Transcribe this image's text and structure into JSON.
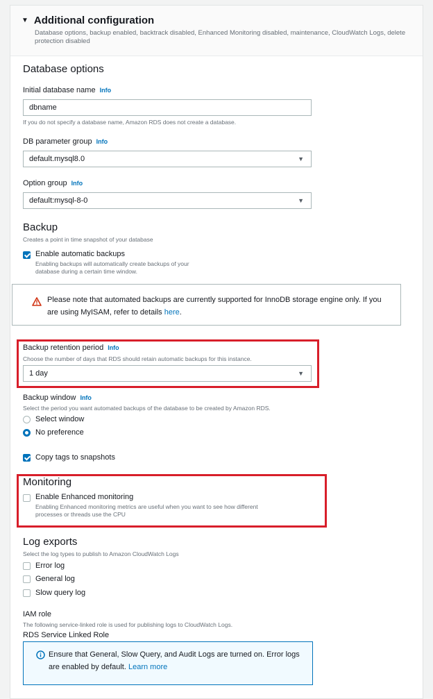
{
  "panel": {
    "title": "Additional configuration",
    "description": "Database options, backup enabled, backtrack disabled, Enhanced Monitoring disabled, maintenance, CloudWatch Logs, delete protection disabled"
  },
  "database_options": {
    "heading": "Database options",
    "initial_db_name": {
      "label": "Initial database name",
      "info": "Info",
      "value": "dbname",
      "hint": "If you do not specify a database name, Amazon RDS does not create a database."
    },
    "parameter_group": {
      "label": "DB parameter group",
      "info": "Info",
      "value": "default.mysql8.0"
    },
    "option_group": {
      "label": "Option group",
      "info": "Info",
      "value": "default:mysql-8-0"
    }
  },
  "backup": {
    "heading": "Backup",
    "description": "Creates a point in time snapshot of your database",
    "enable_auto": {
      "label": "Enable automatic backups",
      "description_line1": "Enabling backups will automatically create backups of your",
      "description_line2": "database during a certain time window.",
      "checked": true
    },
    "warning": {
      "text_line1": "Please note that automated backups are currently supported for InnoDB storage engine only. If you",
      "text_line2": "are using MyISAM, refer to details ",
      "link": "here",
      "suffix": "."
    },
    "retention": {
      "label": "Backup retention period",
      "info": "Info",
      "hint": "Choose the number of days that RDS should retain automatic backups for this instance.",
      "value": "1 day"
    },
    "window": {
      "label": "Backup window",
      "info": "Info",
      "hint": "Select the period you want automated backups of the database to be created by Amazon RDS.",
      "options": [
        {
          "label": "Select window",
          "selected": false
        },
        {
          "label": "No preference",
          "selected": true
        }
      ]
    },
    "copy_tags": {
      "label": "Copy tags to snapshots",
      "checked": true
    }
  },
  "monitoring": {
    "heading": "Monitoring",
    "enhanced": {
      "label": "Enable Enhanced monitoring",
      "description_line1": "Enabling Enhanced monitoring metrics are useful when you want to see how different",
      "description_line2": "processes or threads use the CPU",
      "checked": false
    }
  },
  "log_exports": {
    "heading": "Log exports",
    "description": "Select the log types to publish to Amazon CloudWatch Logs",
    "items": [
      {
        "label": "Error log",
        "checked": false
      },
      {
        "label": "General log",
        "checked": false
      },
      {
        "label": "Slow query log",
        "checked": false
      }
    ]
  },
  "iam_role": {
    "heading": "IAM role",
    "description": "The following service-linked role is used for publishing logs to CloudWatch Logs.",
    "role_name": "RDS Service Linked Role",
    "info_alert": {
      "text_line1": "Ensure that General, Slow Query, and Audit Logs are turned on. Error logs",
      "text_line2": "are enabled by default. ",
      "link": "Learn more"
    }
  },
  "colors": {
    "accent": "#0073bb",
    "highlight_box": "#d81e2a",
    "warning": "#d13212"
  }
}
